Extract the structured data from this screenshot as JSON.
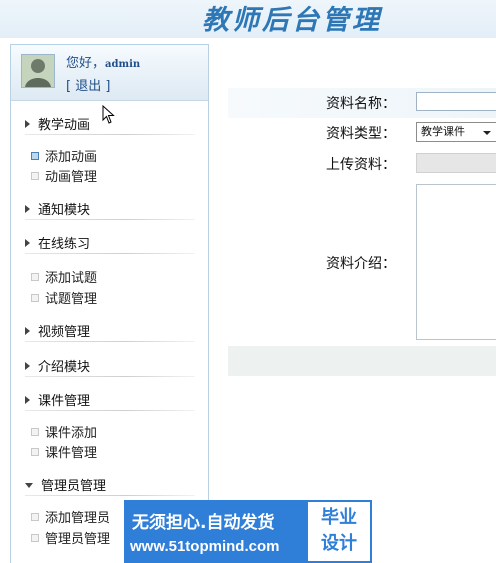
{
  "header": {
    "title": "教师后台管理"
  },
  "user": {
    "greeting": "您好，",
    "name": "admin",
    "logout": "[ 退出 ]"
  },
  "sidebar": {
    "groups": [
      {
        "label": "教学动画",
        "expanded": true,
        "items": [
          "添加动画",
          "动画管理"
        ]
      },
      {
        "label": "通知模块",
        "expanded": false,
        "items": []
      },
      {
        "label": "在线练习",
        "expanded": true,
        "items": [
          "添加试题",
          "试题管理"
        ]
      },
      {
        "label": "视频管理",
        "expanded": false,
        "items": []
      },
      {
        "label": "介绍模块",
        "expanded": false,
        "items": []
      },
      {
        "label": "课件管理",
        "expanded": true,
        "items": [
          "课件添加",
          "课件管理"
        ]
      },
      {
        "label": "管理员管理",
        "expanded": true,
        "items": [
          "添加管理员",
          "管理员管理"
        ]
      }
    ]
  },
  "form": {
    "name_label": "资料名称：",
    "name_value": "",
    "type_label": "资料类型：",
    "type_value": "教学课件",
    "upload_label": "上传资料：",
    "intro_label": "资料介绍：",
    "intro_value": ""
  },
  "promo": {
    "line1": "无须担心.自动发货",
    "line2": "www.51topmind.com",
    "badge_top": "毕业",
    "badge_bottom": "设计"
  },
  "colors": {
    "accent": "#2d77b6",
    "promo": "#2f7ed8",
    "sidebar_border": "#b9cfe2"
  }
}
